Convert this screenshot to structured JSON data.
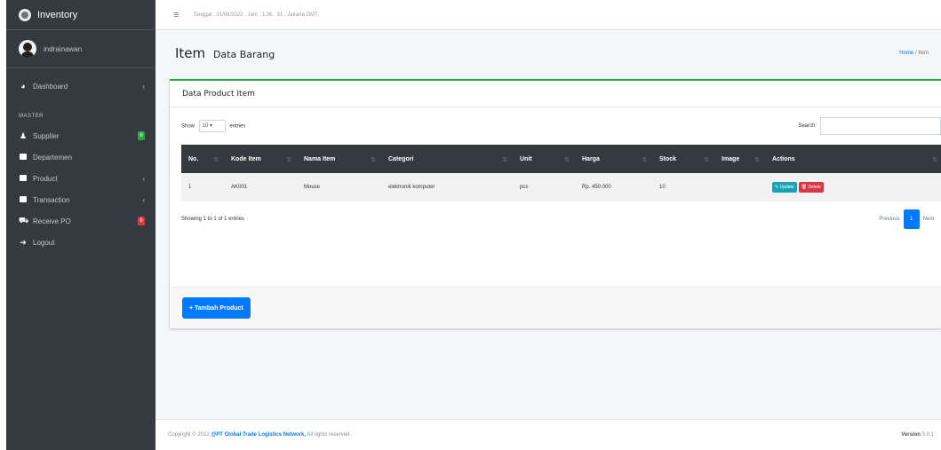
{
  "sidebar": {
    "brand": "Inventory",
    "user": "indrainawan",
    "items": [
      {
        "label": "Dashboard",
        "icon": "tachometer-icon",
        "glyph": "◕",
        "caret": "‹"
      },
      {
        "label": "Supplier",
        "icon": "user-icon",
        "glyph": "♟",
        "badge": "6",
        "badge_color": "#28a745"
      },
      {
        "label": "Departemen",
        "icon": "table-icon"
      },
      {
        "label": "Product",
        "icon": "table-icon",
        "caret": "‹"
      },
      {
        "label": "Transaction",
        "icon": "table-icon",
        "caret": "‹"
      },
      {
        "label": "Receive PO",
        "icon": "truck-icon",
        "glyph": "⛟",
        "badge": "6",
        "badge_color": "#dc3545"
      },
      {
        "label": "Logout",
        "icon": "sign-out-icon",
        "glyph": "➜"
      }
    ],
    "section_header": "MASTER"
  },
  "topbar": {
    "menu_glyph": "≡",
    "datetime": "Tanggal : 01/08/2022 , Jam : 1:36 : 31 , Jakarta GMT"
  },
  "content_header": {
    "title": "Item",
    "subtitle": "Data Barang",
    "breadcrumb_home": "Home",
    "breadcrumb_sep": "/",
    "breadcrumb_current": "Item"
  },
  "card": {
    "title": "Data Product Item",
    "show_label": "Show",
    "entries_value": "10",
    "entries_label": "entries",
    "search_label": "Search:",
    "search_value": "",
    "columns": [
      "No.",
      "Kode Item",
      "Nama Item",
      "Categori",
      "Unit",
      "Harga",
      "Stock",
      "Image",
      "Actions"
    ],
    "rows": [
      {
        "no": "1",
        "kode": "AK001",
        "nama": "Mouse",
        "categori": "elektronik komputer",
        "unit": "pcs",
        "harga": "Rp. 450.000",
        "stock": "10",
        "image": ""
      }
    ],
    "update_label": "Update",
    "delete_label": "Delete",
    "info": "Showing 1 to 1 of 1 entries",
    "prev": "Previous",
    "page": "1",
    "next": "Next",
    "add_button": "+ Tambah Product"
  },
  "footer": {
    "copyright": "Copyright © 2022",
    "company": "@PT Global Trade Logistics Network,",
    "rights": "All rights reserved.",
    "version_label": "Version",
    "version": "3.0.1"
  },
  "colors": {
    "sidebar_bg": "#343a40",
    "accent_blue": "#007bff",
    "card_top": "#28a745",
    "delete_red": "#dc3545",
    "update_teal": "#17a2b8"
  }
}
